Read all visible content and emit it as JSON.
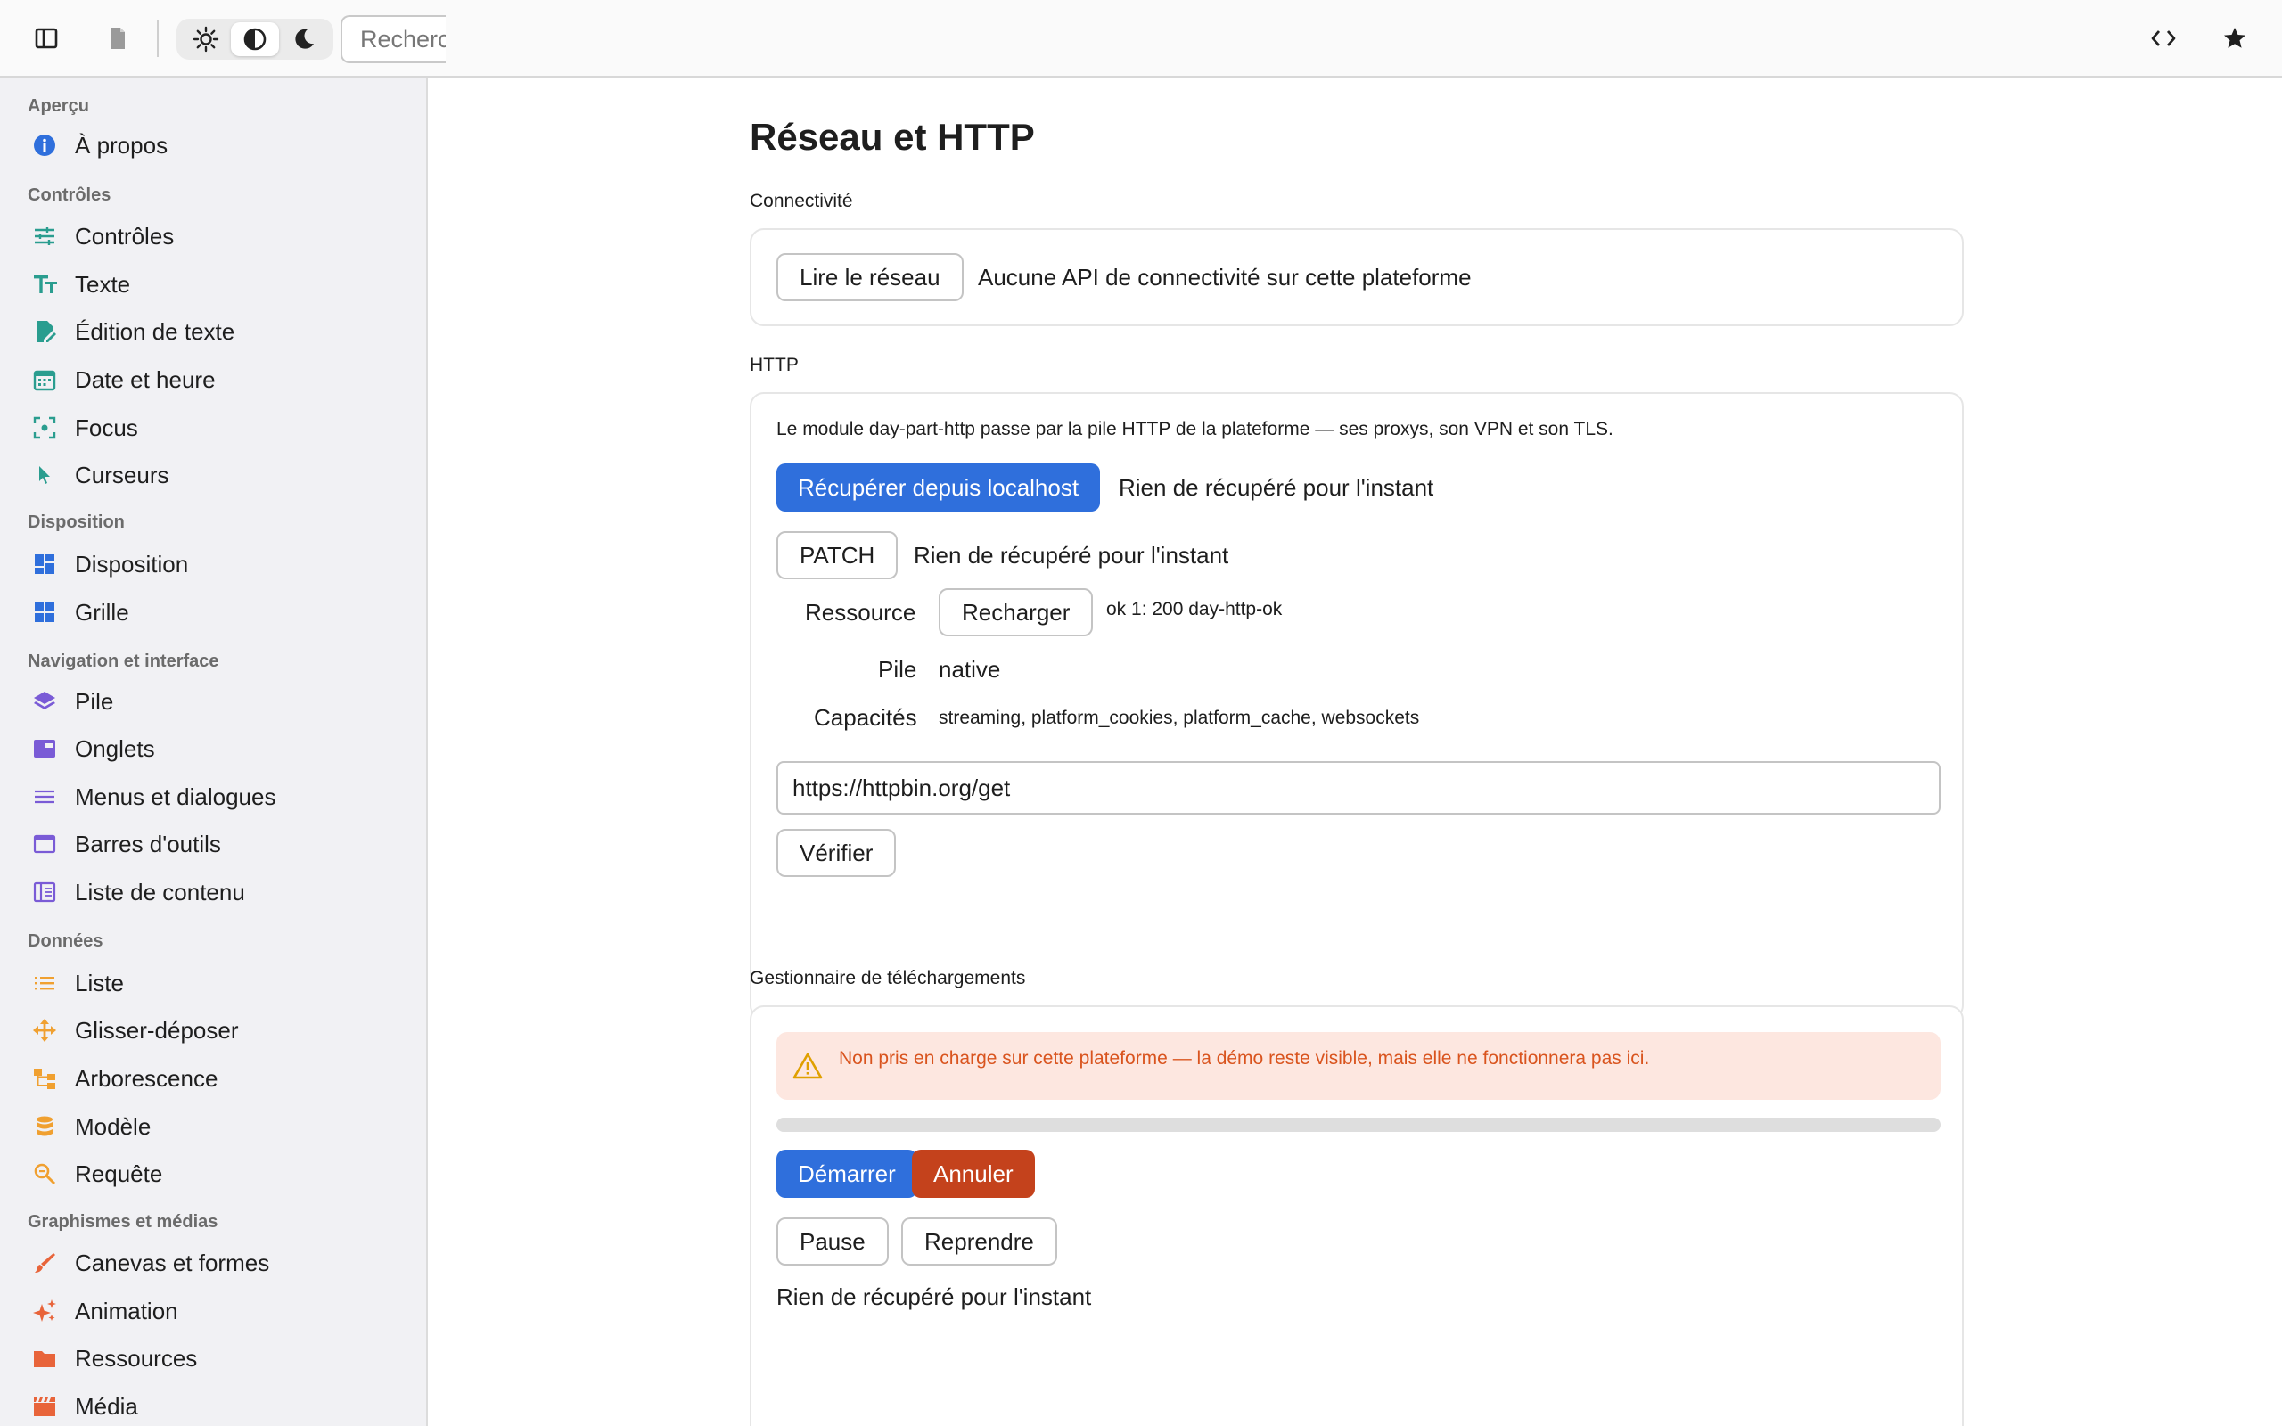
{
  "topbar": {
    "search_placeholder": "Rechercher"
  },
  "sidebar": {
    "sections": [
      {
        "title": "Aperçu",
        "items": [
          {
            "label": "À propos",
            "icon": "info-icon"
          }
        ]
      },
      {
        "title": "Contrôles",
        "items": [
          {
            "label": "Contrôles",
            "icon": "sliders-icon"
          },
          {
            "label": "Texte",
            "icon": "text-size-icon"
          },
          {
            "label": "Édition de texte",
            "icon": "edit-document-icon"
          },
          {
            "label": "Date et heure",
            "icon": "calendar-icon"
          },
          {
            "label": "Focus",
            "icon": "focus-icon"
          },
          {
            "label": "Curseurs",
            "icon": "cursor-icon"
          }
        ]
      },
      {
        "title": "Disposition",
        "items": [
          {
            "label": "Disposition",
            "icon": "dashboard-icon"
          },
          {
            "label": "Grille",
            "icon": "grid-icon"
          }
        ]
      },
      {
        "title": "Navigation et interface",
        "items": [
          {
            "label": "Pile",
            "icon": "layers-icon"
          },
          {
            "label": "Onglets",
            "icon": "tabs-icon"
          },
          {
            "label": "Menus et dialogues",
            "icon": "menu-icon"
          },
          {
            "label": "Barres d'outils",
            "icon": "toolbar-icon"
          },
          {
            "label": "Liste de contenu",
            "icon": "content-list-icon"
          }
        ]
      },
      {
        "title": "Données",
        "items": [
          {
            "label": "Liste",
            "icon": "list-icon"
          },
          {
            "label": "Glisser-déposer",
            "icon": "drag-move-icon"
          },
          {
            "label": "Arborescence",
            "icon": "tree-icon"
          },
          {
            "label": "Modèle",
            "icon": "database-icon"
          },
          {
            "label": "Requête",
            "icon": "search-zoom-icon"
          }
        ]
      },
      {
        "title": "Graphismes et médias",
        "items": [
          {
            "label": "Canevas et formes",
            "icon": "brush-icon"
          },
          {
            "label": "Animation",
            "icon": "sparkle-icon"
          },
          {
            "label": "Ressources",
            "icon": "folder-icon"
          },
          {
            "label": "Média",
            "icon": "clapperboard-icon"
          }
        ]
      }
    ]
  },
  "main": {
    "title": "Réseau et HTTP",
    "connectivity": {
      "label": "Connectivité",
      "button": "Lire le réseau",
      "status": "Aucune API de connectivité sur cette plateforme"
    },
    "http": {
      "label": "HTTP",
      "description": "Le module day-part-http passe par la pile HTTP de la plateforme — ses proxys, son VPN et son TLS.",
      "fetch_button": "Récupérer depuis localhost",
      "fetch_status": "Rien de récupéré pour l'instant",
      "patch_button": "PATCH",
      "patch_status": "Rien de récupéré pour l'instant",
      "resource_label": "Ressource",
      "reload_button": "Recharger",
      "resource_value": "ok 1: 200 day-http-ok",
      "stack_label": "Pile",
      "stack_value": "native",
      "capabilities_label": "Capacités",
      "capabilities_value": "streaming, platform_cookies, platform_cache, websockets",
      "url_value": "https://httpbin.org/get",
      "verify_button": "Vérifier"
    },
    "downloads": {
      "label": "Gestionnaire de téléchargements",
      "warning": "Non pris en charge sur cette plateforme — la démo reste visible, mais elle ne fonctionnera pas ici.",
      "progress": 0,
      "start_button": "Démarrer",
      "cancel_button": "Annuler",
      "pause_button": "Pause",
      "resume_button": "Reprendre",
      "status": "Rien de récupéré pour l'instant"
    }
  },
  "colors": {
    "accent_blue": "#2f6fdc",
    "danger_red": "#c4421c",
    "warning_bg": "#fde7e0",
    "warning_text": "#d9541e",
    "icon_teal": "#2a9d8f",
    "icon_blue": "#2f6fdc",
    "icon_purple": "#7a5bd6",
    "icon_orange": "#f0a030",
    "icon_red_orange": "#e8643a"
  }
}
